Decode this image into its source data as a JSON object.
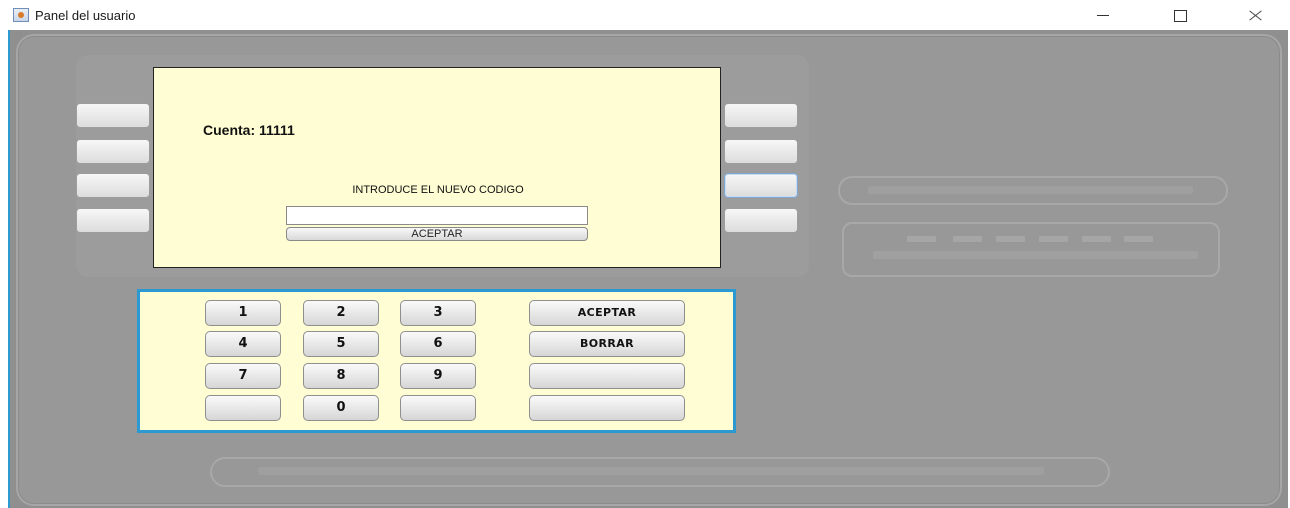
{
  "window": {
    "title": "Panel del usuario"
  },
  "screen": {
    "account_text": "Cuenta: 11111",
    "prompt": "INTRODUCE EL NUEVO CODIGO",
    "code_value": "",
    "accept_label": "ACEPTAR"
  },
  "keypad": {
    "keys": [
      "1",
      "2",
      "3",
      "4",
      "5",
      "6",
      "7",
      "8",
      "9",
      "",
      "0",
      ""
    ],
    "func": [
      "ACEPTAR",
      "BORRAR",
      "",
      ""
    ]
  },
  "colors": {
    "screen_bg": "#fffdd3",
    "keypad_border": "#2c9ad0",
    "machine_bg": "#989898"
  }
}
